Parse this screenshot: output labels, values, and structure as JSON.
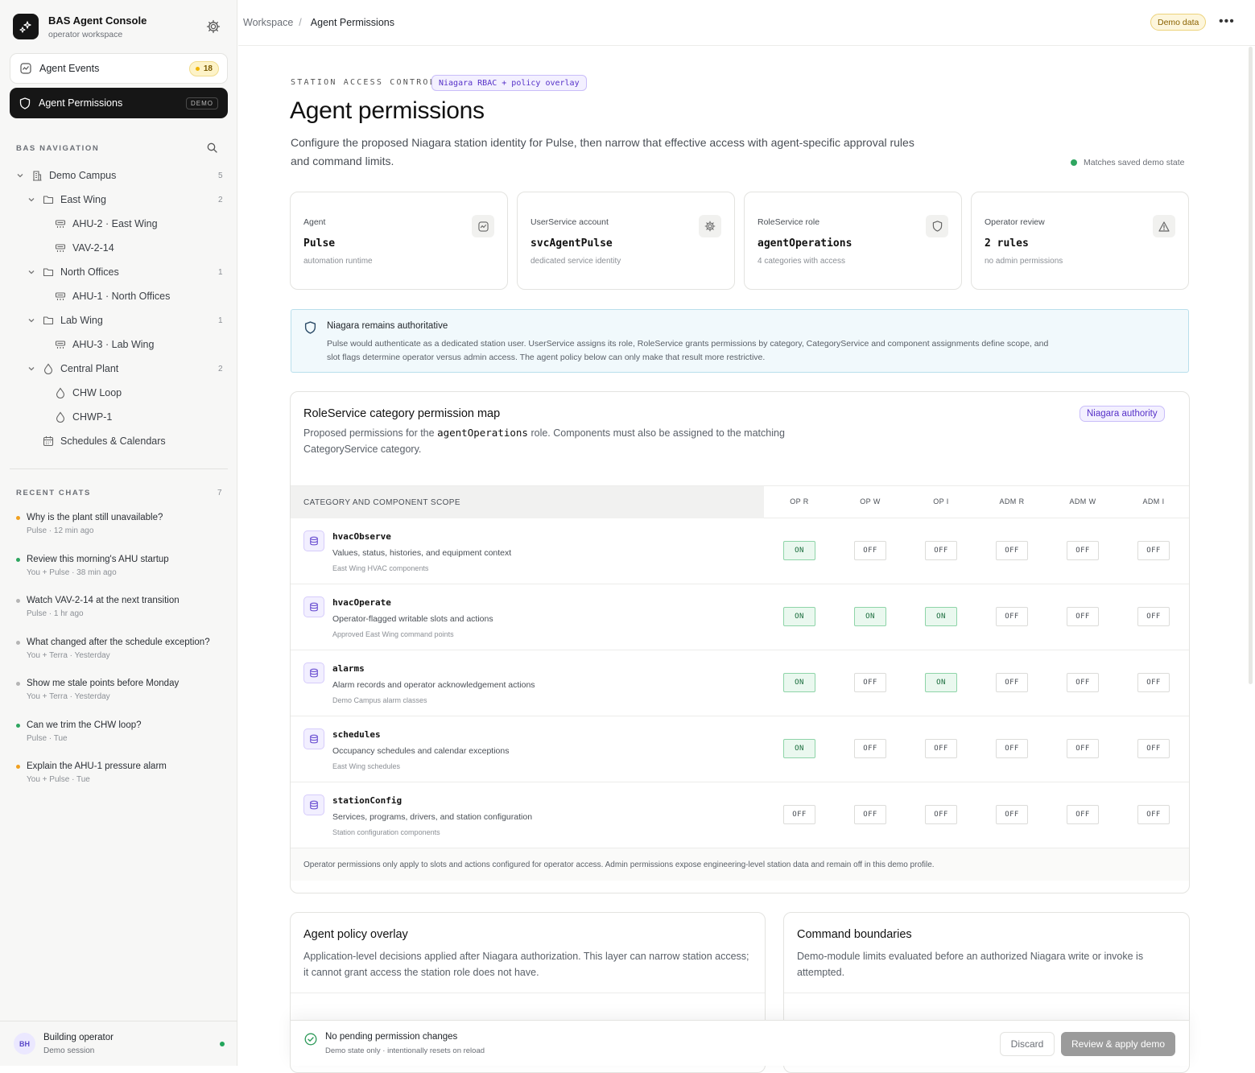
{
  "sidebar": {
    "brand_title": "BAS Agent Console",
    "brand_subtitle": "operator workspace",
    "events_label": "Agent Events",
    "events_count": "18",
    "permissions_label": "Agent Permissions",
    "permissions_tag": "DEMO",
    "nav_heading": "BAS NAVIGATION",
    "tree": [
      {
        "label": "Demo Campus",
        "count": "5"
      },
      {
        "label": "East Wing",
        "count": "2"
      },
      {
        "label": "AHU-2 · East Wing"
      },
      {
        "label": "VAV-2-14"
      },
      {
        "label": "North Offices",
        "count": "1"
      },
      {
        "label": "AHU-1 · North Offices"
      },
      {
        "label": "Lab Wing",
        "count": "1"
      },
      {
        "label": "AHU-3 · Lab Wing"
      },
      {
        "label": "Central Plant",
        "count": "2"
      },
      {
        "label": "CHW Loop"
      },
      {
        "label": "CHWP-1"
      },
      {
        "label": "Schedules & Calendars"
      }
    ],
    "chats_heading": "RECENT CHATS",
    "chats_count": "7",
    "chats": [
      {
        "title": "Why is the plant still unavailable?",
        "meta": "Pulse · 12 min ago",
        "dot": "#f0a020"
      },
      {
        "title": "Review this morning's AHU startup",
        "meta": "You + Pulse · 38 min ago",
        "dot": "#2ea660"
      },
      {
        "title": "Watch VAV-2-14 at the next transition",
        "meta": "Pulse · 1 hr ago",
        "dot": "#b5b5b5"
      },
      {
        "title": "What changed after the schedule exception?",
        "meta": "You + Terra · Yesterday",
        "dot": "#b5b5b5"
      },
      {
        "title": "Show me stale points before Monday",
        "meta": "You + Terra · Yesterday",
        "dot": "#b5b5b5"
      },
      {
        "title": "Can we trim the CHW loop?",
        "meta": "Pulse · Tue",
        "dot": "#2ea660"
      },
      {
        "title": "Explain the AHU-1 pressure alarm",
        "meta": "You + Pulse · Tue",
        "dot": "#f0a020"
      }
    ],
    "user_initials": "BH",
    "user_name": "Building operator",
    "user_session": "Demo session"
  },
  "topbar": {
    "crumb_root": "Workspace",
    "crumb_current": "Agent Permissions",
    "demo_badge": "Demo data"
  },
  "header": {
    "eyebrow": "STATION ACCESS CONTROL",
    "eyebrow_pill": "Niagara RBAC + policy overlay",
    "title": "Agent permissions",
    "lead": "Configure the proposed Niagara station identity for Pulse, then narrow that effective access with agent-specific approval rules and command limits.",
    "match_status": "Matches saved demo state"
  },
  "cards": [
    {
      "key": "Agent",
      "value": "Pulse",
      "desc": "automation runtime",
      "icon": "activity-icon"
    },
    {
      "key": "UserService account",
      "value": "svcAgentPulse",
      "desc": "dedicated service identity",
      "icon": "gear-icon"
    },
    {
      "key": "RoleService role",
      "value": "agentOperations",
      "desc": "4 categories with access",
      "icon": "shield-icon"
    },
    {
      "key": "Operator review",
      "value": "2 rules",
      "desc": "no admin permissions",
      "icon": "warning-icon"
    }
  ],
  "notice": {
    "title": "Niagara remains authoritative",
    "body": "Pulse would authenticate as a dedicated station user. UserService assigns its role, RoleService grants permissions by category, CategoryService and component assignments define scope, and slot flags determine operator versus admin access. The agent policy below can only make that result more restrictive."
  },
  "perm_map": {
    "title": "RoleService category permission map",
    "badge": "Niagara authority",
    "desc_before": "Proposed permissions for the",
    "desc_role": "agentOperations",
    "desc_after": "role. Components must also be assigned to the matching CategoryService category.",
    "col_scope": "CATEGORY AND COMPONENT SCOPE",
    "columns": [
      "OP R",
      "OP W",
      "OP I",
      "ADM R",
      "ADM W",
      "ADM I"
    ],
    "rows": [
      {
        "name": "hvacObserve",
        "desc": "Values, status, histories, and equipment context",
        "scope": "East Wing HVAC components",
        "perms": [
          "ON",
          "OFF",
          "OFF",
          "OFF",
          "OFF",
          "OFF"
        ]
      },
      {
        "name": "hvacOperate",
        "desc": "Operator-flagged writable slots and actions",
        "scope": "Approved East Wing command points",
        "perms": [
          "ON",
          "ON",
          "ON",
          "OFF",
          "OFF",
          "OFF"
        ]
      },
      {
        "name": "alarms",
        "desc": "Alarm records and operator acknowledgement actions",
        "scope": "Demo Campus alarm classes",
        "perms": [
          "ON",
          "OFF",
          "ON",
          "OFF",
          "OFF",
          "OFF"
        ]
      },
      {
        "name": "schedules",
        "desc": "Occupancy schedules and calendar exceptions",
        "scope": "East Wing schedules",
        "perms": [
          "ON",
          "OFF",
          "OFF",
          "OFF",
          "OFF",
          "OFF"
        ]
      },
      {
        "name": "stationConfig",
        "desc": "Services, programs, drivers, and station configuration",
        "scope": "Station configuration components",
        "perms": [
          "OFF",
          "OFF",
          "OFF",
          "OFF",
          "OFF",
          "OFF"
        ]
      }
    ],
    "footnote": "Operator permissions only apply to slots and actions configured for operator access. Admin permissions expose engineering-level station data and remain off in this demo profile."
  },
  "policy": {
    "title": "Agent policy overlay",
    "desc": "Application-level decisions applied after Niagara authorization. This layer can narrow station access; it cannot grant access the station role does not have."
  },
  "boundaries": {
    "title": "Command boundaries",
    "desc": "Demo-module limits evaluated before an authorized Niagara write or invoke is attempted."
  },
  "footer": {
    "status": "No pending permission changes",
    "sub": "Demo state only · intentionally resets on reload",
    "discard": "Discard",
    "apply": "Review & apply demo"
  }
}
